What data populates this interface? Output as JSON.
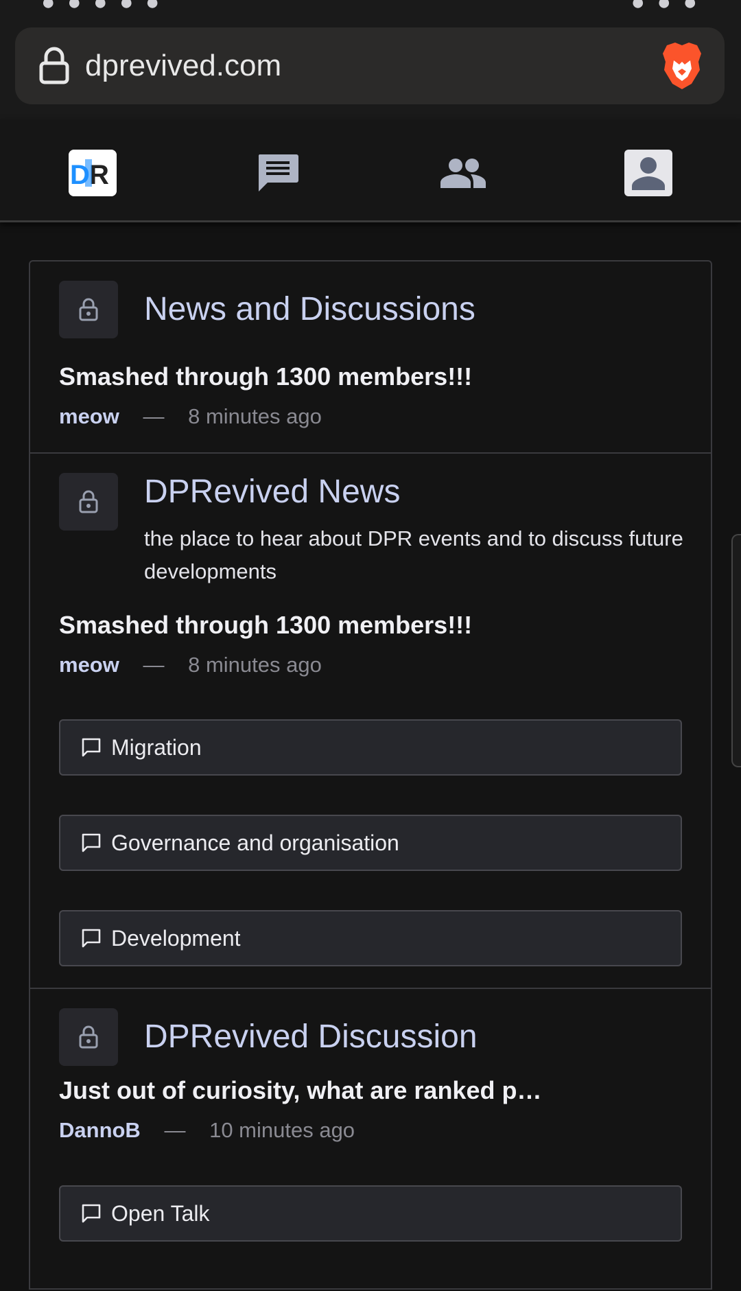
{
  "browser": {
    "url": "dprevived.com"
  },
  "nav": {
    "items": [
      {
        "name": "logo",
        "icon": "dpr-logo"
      },
      {
        "name": "chat",
        "icon": "chat-icon"
      },
      {
        "name": "people",
        "icon": "people-icon"
      },
      {
        "name": "profile",
        "icon": "profile-icon"
      }
    ]
  },
  "sections": [
    {
      "title": "News and Discussions",
      "post": {
        "title": "Smashed through 1300 members!!!",
        "author": "meow",
        "dash": "—",
        "time": "8 minutes ago"
      }
    },
    {
      "title": "DPRevived News",
      "description": "the place to hear about DPR events and to discuss future developments",
      "post": {
        "title": "Smashed through 1300 members!!!",
        "author": "meow",
        "dash": "—",
        "time": "8 minutes ago"
      },
      "subforums": [
        "Migration",
        "Governance and organisation",
        "Development"
      ]
    },
    {
      "title": "DPRevived Discussion",
      "post": {
        "title": "Just out of curiosity, what are ranked p…",
        "author": "DannoB",
        "dash": "—",
        "time": "10 minutes ago"
      },
      "subforums": [
        "Open Talk"
      ]
    }
  ],
  "colors": {
    "background": "#121212",
    "accent_title": "#c9d1f0",
    "muted": "#8a8a92"
  }
}
